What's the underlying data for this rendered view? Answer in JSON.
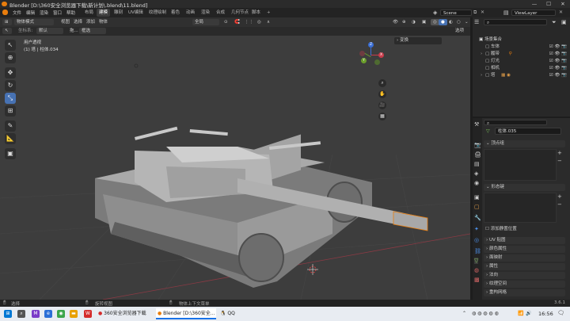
{
  "window": {
    "title": "Blender [D:\\360安全浏览器下载\\新计划\\.blend\\11.blend]",
    "minimize": "—",
    "maximize": "☐",
    "close": "✕"
  },
  "menu": [
    "文件",
    "编辑",
    "渲染",
    "窗口",
    "帮助"
  ],
  "workspaces": [
    "布局",
    "建模",
    "雕刻",
    "UV编辑",
    "纹理绘制",
    "着色",
    "动画",
    "渲染",
    "合成",
    "几何节点",
    "脚本"
  ],
  "active_workspace": "建模",
  "scene": {
    "label": "Scene"
  },
  "view_layer": {
    "label": "ViewLayer"
  },
  "viewport_header": {
    "mode": "物体模式",
    "menus": [
      "视图",
      "选择",
      "添加",
      "物体"
    ],
    "transform": "全局",
    "options_label": "选项"
  },
  "viewport_header2": {
    "orientation_label": "坐标系:",
    "orientation_value": "默认",
    "drag_label": "拖...",
    "select_value": "框选"
  },
  "viewport": {
    "view_name": "用户透视",
    "object_info": "(1) 塔 | 柱体.034",
    "n_panel_label": "变换",
    "axis": {
      "x": "X",
      "y": "Y",
      "z": "Z"
    }
  },
  "tools": [
    "select",
    "cursor",
    "move",
    "rotate",
    "scale",
    "transform",
    "annotate",
    "measure",
    "add-cube"
  ],
  "outliner": {
    "search_placeholder": "",
    "items": [
      {
        "label": "场景集合",
        "indent": 0
      },
      {
        "label": "车体",
        "indent": 1
      },
      {
        "label": "履带",
        "indent": 1
      },
      {
        "label": "灯光",
        "indent": 1
      },
      {
        "label": "相机",
        "indent": 1
      },
      {
        "label": "塔",
        "indent": 1
      }
    ]
  },
  "properties": {
    "object_name": "柱体.035",
    "sections_top": [
      "顶点组",
      "形态键"
    ],
    "add_rest_position": "添加静置位置",
    "sections": [
      "UV 贴图",
      "颜色属性",
      "面映射",
      "属性",
      "法向",
      "纹理空间",
      "重构网格"
    ]
  },
  "status": {
    "left": "选择",
    "middle": "旋转视图",
    "right": "物体上下文菜单",
    "version": "3.6.1"
  },
  "taskbar": {
    "tasks": [
      {
        "label": "360安全浏览器下载"
      },
      {
        "label": "Blender [D:\\360安全...",
        "active": true
      },
      {
        "label": "QQ"
      }
    ],
    "time": "16:56"
  },
  "colors": {
    "accent": "#4772b3",
    "active_object_orange": "#e87d0d",
    "axis_x": "#c83c4b",
    "axis_y": "#6b9e2b",
    "axis_z": "#3b6fd6"
  }
}
